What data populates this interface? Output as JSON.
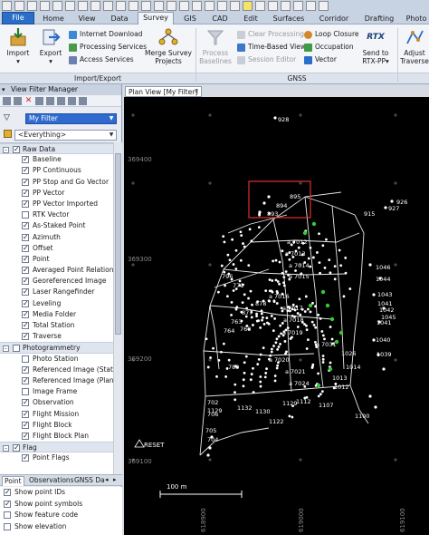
{
  "tabs": [
    "File",
    "Home",
    "View",
    "Data",
    "Survey",
    "GIS",
    "CAD",
    "Edit",
    "Surfaces",
    "Corridor",
    "Drafting",
    "Photo"
  ],
  "active_tab": "Survey",
  "ribbon": {
    "import_label": "Import",
    "export_label": "Export",
    "internet_download": "Internet Download",
    "processing_services": "Processing Services",
    "access_services": "Access Services",
    "merge_survey_projects": "Merge Survey Projects",
    "group_import_export": "Import/Export",
    "process_baselines": "Process Baselines",
    "clear_processing": "Clear Processing",
    "time_based_view": "Time-Based View",
    "session_editor": "Session Editor",
    "loop_closure": "Loop Closure",
    "occupation": "Occupation",
    "vector": "Vector",
    "send_to_rtx_pp": "Send to RTX-PP",
    "rtx_badge": "RTX",
    "group_gnss": "GNSS",
    "adjust_traverse": "Adjust Traverse"
  },
  "left_panel": {
    "title": "View Filter Manager",
    "filter_value": "My Filter",
    "everything_value": "<Everything>",
    "tree": [
      {
        "label": "Raw Data",
        "group": true,
        "checked": true
      },
      {
        "label": "Baseline",
        "checked": true
      },
      {
        "label": "PP Continuous",
        "checked": true
      },
      {
        "label": "PP Stop and Go Vector",
        "checked": true
      },
      {
        "label": "PP Vector",
        "checked": true
      },
      {
        "label": "PP Vector Imported",
        "checked": true
      },
      {
        "label": "RTK Vector",
        "checked": false
      },
      {
        "label": "As-Staked Point",
        "checked": true
      },
      {
        "label": "Azimuth",
        "checked": true
      },
      {
        "label": "Offset",
        "checked": true
      },
      {
        "label": "Point",
        "checked": true
      },
      {
        "label": "Averaged Point Relations",
        "checked": true
      },
      {
        "label": "Georeferenced Image",
        "checked": true
      },
      {
        "label": "Laser Rangefinder",
        "checked": true
      },
      {
        "label": "Leveling",
        "checked": true
      },
      {
        "label": "Media Folder",
        "checked": true
      },
      {
        "label": "Total Station",
        "checked": true
      },
      {
        "label": "Traverse",
        "checked": true
      },
      {
        "label": "Photogrammetry",
        "group": true,
        "checked": false
      },
      {
        "label": "Photo Station",
        "checked": false
      },
      {
        "label": "Referenced Image (Statio",
        "checked": true
      },
      {
        "label": "Referenced Image (Plan",
        "checked": true
      },
      {
        "label": "Image Frame",
        "checked": false
      },
      {
        "label": "Observation",
        "checked": true
      },
      {
        "label": "Flight Mission",
        "checked": true
      },
      {
        "label": "Flight Block",
        "checked": true
      },
      {
        "label": "Flight Block Plan",
        "checked": true
      },
      {
        "label": "Flag",
        "group": true,
        "checked": true
      },
      {
        "label": "Point Flags",
        "checked": true
      }
    ],
    "bottom_tabs": [
      "Point",
      "Observations",
      "GNSS Da"
    ],
    "options": [
      {
        "label": "Show point IDs",
        "checked": true
      },
      {
        "label": "Show point symbols",
        "checked": true
      },
      {
        "label": "Show feature code",
        "checked": false
      },
      {
        "label": "Show elevation",
        "checked": false
      }
    ]
  },
  "plan_view": {
    "tab_title": "Plan View [My Filter]",
    "northings": [
      "369400",
      "369300",
      "369200",
      "369100"
    ],
    "eastings": [
      "618900",
      "619000",
      "619100"
    ],
    "scale_label": "100 m",
    "reset_label": "RESET",
    "point_labels": [
      {
        "t": "928"
      },
      {
        "t": "926"
      },
      {
        "t": "927"
      },
      {
        "t": "895"
      },
      {
        "t": "894"
      },
      {
        "t": "893"
      },
      {
        "t": "915"
      },
      {
        "t": "a 7012"
      },
      {
        "t": "a 7013"
      },
      {
        "t": "a 7014"
      },
      {
        "t": "a 7015"
      },
      {
        "t": "a 7016"
      },
      {
        "t": "a 7017"
      },
      {
        "t": "a 7018"
      },
      {
        "t": "a 7019"
      },
      {
        "t": "a 7020"
      },
      {
        "t": "a 7021"
      },
      {
        "t": "a 7024"
      },
      {
        "t": "a 7031"
      },
      {
        "t": "1046"
      },
      {
        "t": "1044"
      },
      {
        "t": "1043"
      },
      {
        "t": "1042"
      },
      {
        "t": "1041"
      },
      {
        "t": "1040"
      },
      {
        "t": "1039"
      },
      {
        "t": "1026"
      },
      {
        "t": "1129"
      },
      {
        "t": "1132"
      },
      {
        "t": "1130"
      },
      {
        "t": "1122"
      },
      {
        "t": "1112"
      },
      {
        "t": "1107"
      },
      {
        "t": "1100"
      },
      {
        "t": "1129"
      },
      {
        "t": "878"
      },
      {
        "t": "877"
      },
      {
        "t": "771"
      },
      {
        "t": "764"
      },
      {
        "t": "763"
      },
      {
        "t": "760"
      },
      {
        "t": "796"
      },
      {
        "t": "780"
      },
      {
        "t": "1041"
      },
      {
        "t": "1012"
      },
      {
        "t": "1014"
      },
      {
        "t": "1013"
      },
      {
        "t": "702"
      },
      {
        "t": "706"
      },
      {
        "t": "705"
      },
      {
        "t": "704"
      },
      {
        "t": "1045"
      }
    ]
  },
  "colors": {
    "accent": "#2a6ec9",
    "canvas_bg": "#000000",
    "point_fill": "#ffffff",
    "green_points": "#35c837",
    "selection_box": "#e03030"
  }
}
